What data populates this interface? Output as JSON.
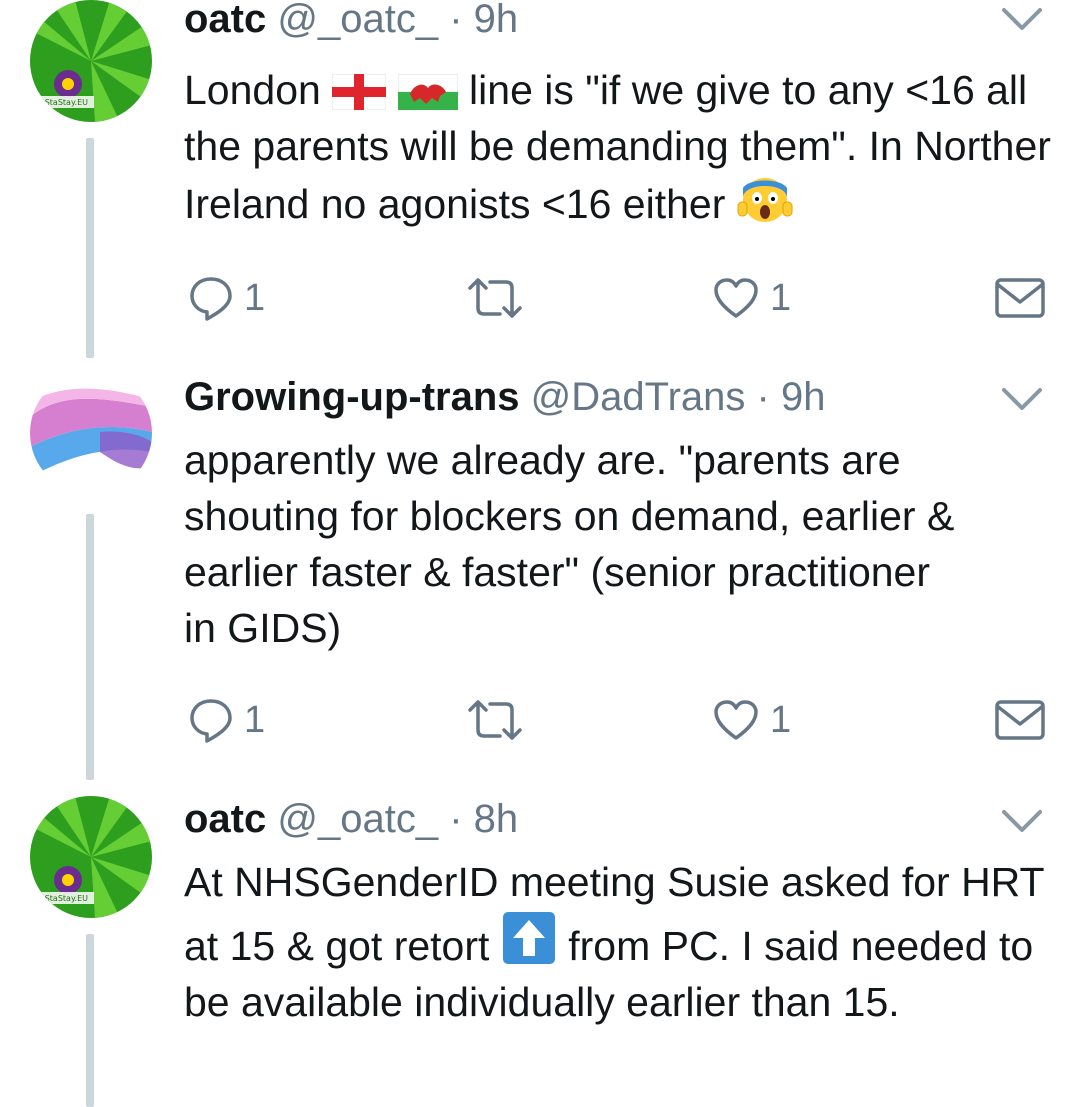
{
  "tweets": [
    {
      "name": "oatc",
      "handle": "@_oatc_",
      "separator": "·",
      "time": "9h",
      "text_parts": [
        "London",
        "line is \"if we give to any <16 all the parents will be demanding them\". In Norther Ireland no agonists <16 either"
      ],
      "avatar_text": "#StaStay.EU",
      "replies": "1",
      "retweets": "",
      "likes": "1"
    },
    {
      "name": "Growing-up-trans",
      "handle": "@DadTrans",
      "separator": "·",
      "time": "9h",
      "text_lines": [
        "apparently we already are. \"parents are",
        "shouting for blockers on demand, earlier &",
        "earlier faster & faster\" (senior practitioner",
        "in GIDS)"
      ],
      "replies": "1",
      "retweets": "",
      "likes": "1"
    },
    {
      "name": "oatc",
      "handle": "@_oatc_",
      "separator": "·",
      "time": "8h",
      "text_parts": [
        "At NHSGenderID meeting Susie asked for HRT at 15 & got retort",
        "from PC. I said needed to be available individually earlier than 15."
      ],
      "avatar_text": "#StaStay.EU"
    }
  ],
  "icons": {
    "reply": "reply-icon",
    "retweet": "retweet-icon",
    "like": "heart-icon",
    "dm": "envelope-icon",
    "more": "chevron-down-icon",
    "flag_england": "england-flag-icon",
    "flag_wales": "wales-flag-icon",
    "screaming": "screaming-face-icon",
    "up_arrow": "up-arrow-icon"
  },
  "colors": {
    "secondary_text": "#657786",
    "thread_line": "#ccd6dd",
    "avatar_green": "#2e9e1f"
  }
}
